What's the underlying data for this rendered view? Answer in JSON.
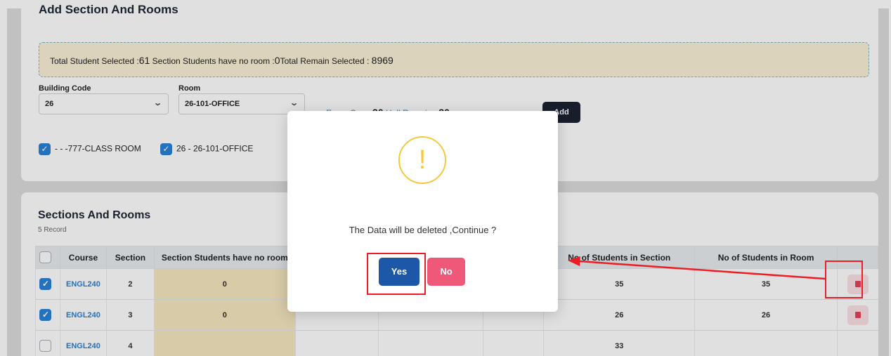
{
  "top_card": {
    "title": "Add Section And Rooms",
    "info_prefix_1": "Total Student Selected :",
    "total_selected": "61",
    "info_prefix_2": " Section Students have no room :",
    "no_room": "0",
    "info_prefix_3": "Total Remain Selected : ",
    "total_remain": "8969",
    "building_label": "Building Code",
    "building_value": "26",
    "room_label": "Room",
    "room_value": "26-101-OFFICE",
    "exam_cap_label": "Exam Cap : ",
    "exam_cap_value": "30",
    "hall_remain_label": " Hall Remain : ",
    "hall_remain_value": "30",
    "add_button": "Add",
    "checkbox_1": "- - -777-CLASS ROOM",
    "checkbox_2": "26 - 26-101-OFFICE"
  },
  "sections": {
    "title": "Sections And Rooms",
    "record_count": "5 Record",
    "columns": [
      "Course",
      "Section",
      "Section Students have no room",
      "",
      "",
      "",
      "No of Students in Section",
      "No of Students in Room",
      ""
    ],
    "rows": [
      {
        "checked": true,
        "course": "ENGL240",
        "section": "2",
        "no_room": "0",
        "in_section": "35",
        "in_room": "35"
      },
      {
        "checked": true,
        "course": "ENGL240",
        "section": "3",
        "no_room": "0",
        "in_section": "26",
        "in_room": "26"
      },
      {
        "checked": false,
        "course": "ENGL240",
        "section": "4",
        "no_room": "",
        "in_section": "33",
        "in_room": ""
      }
    ]
  },
  "modal": {
    "icon": "warning-icon",
    "message": "The Data will be deleted ,Continue ?",
    "yes": "Yes",
    "no": "No"
  },
  "colors": {
    "primary": "#1c57a8",
    "danger": "#f0587a",
    "annotation": "#ee1c24",
    "warning": "#f5c842"
  }
}
